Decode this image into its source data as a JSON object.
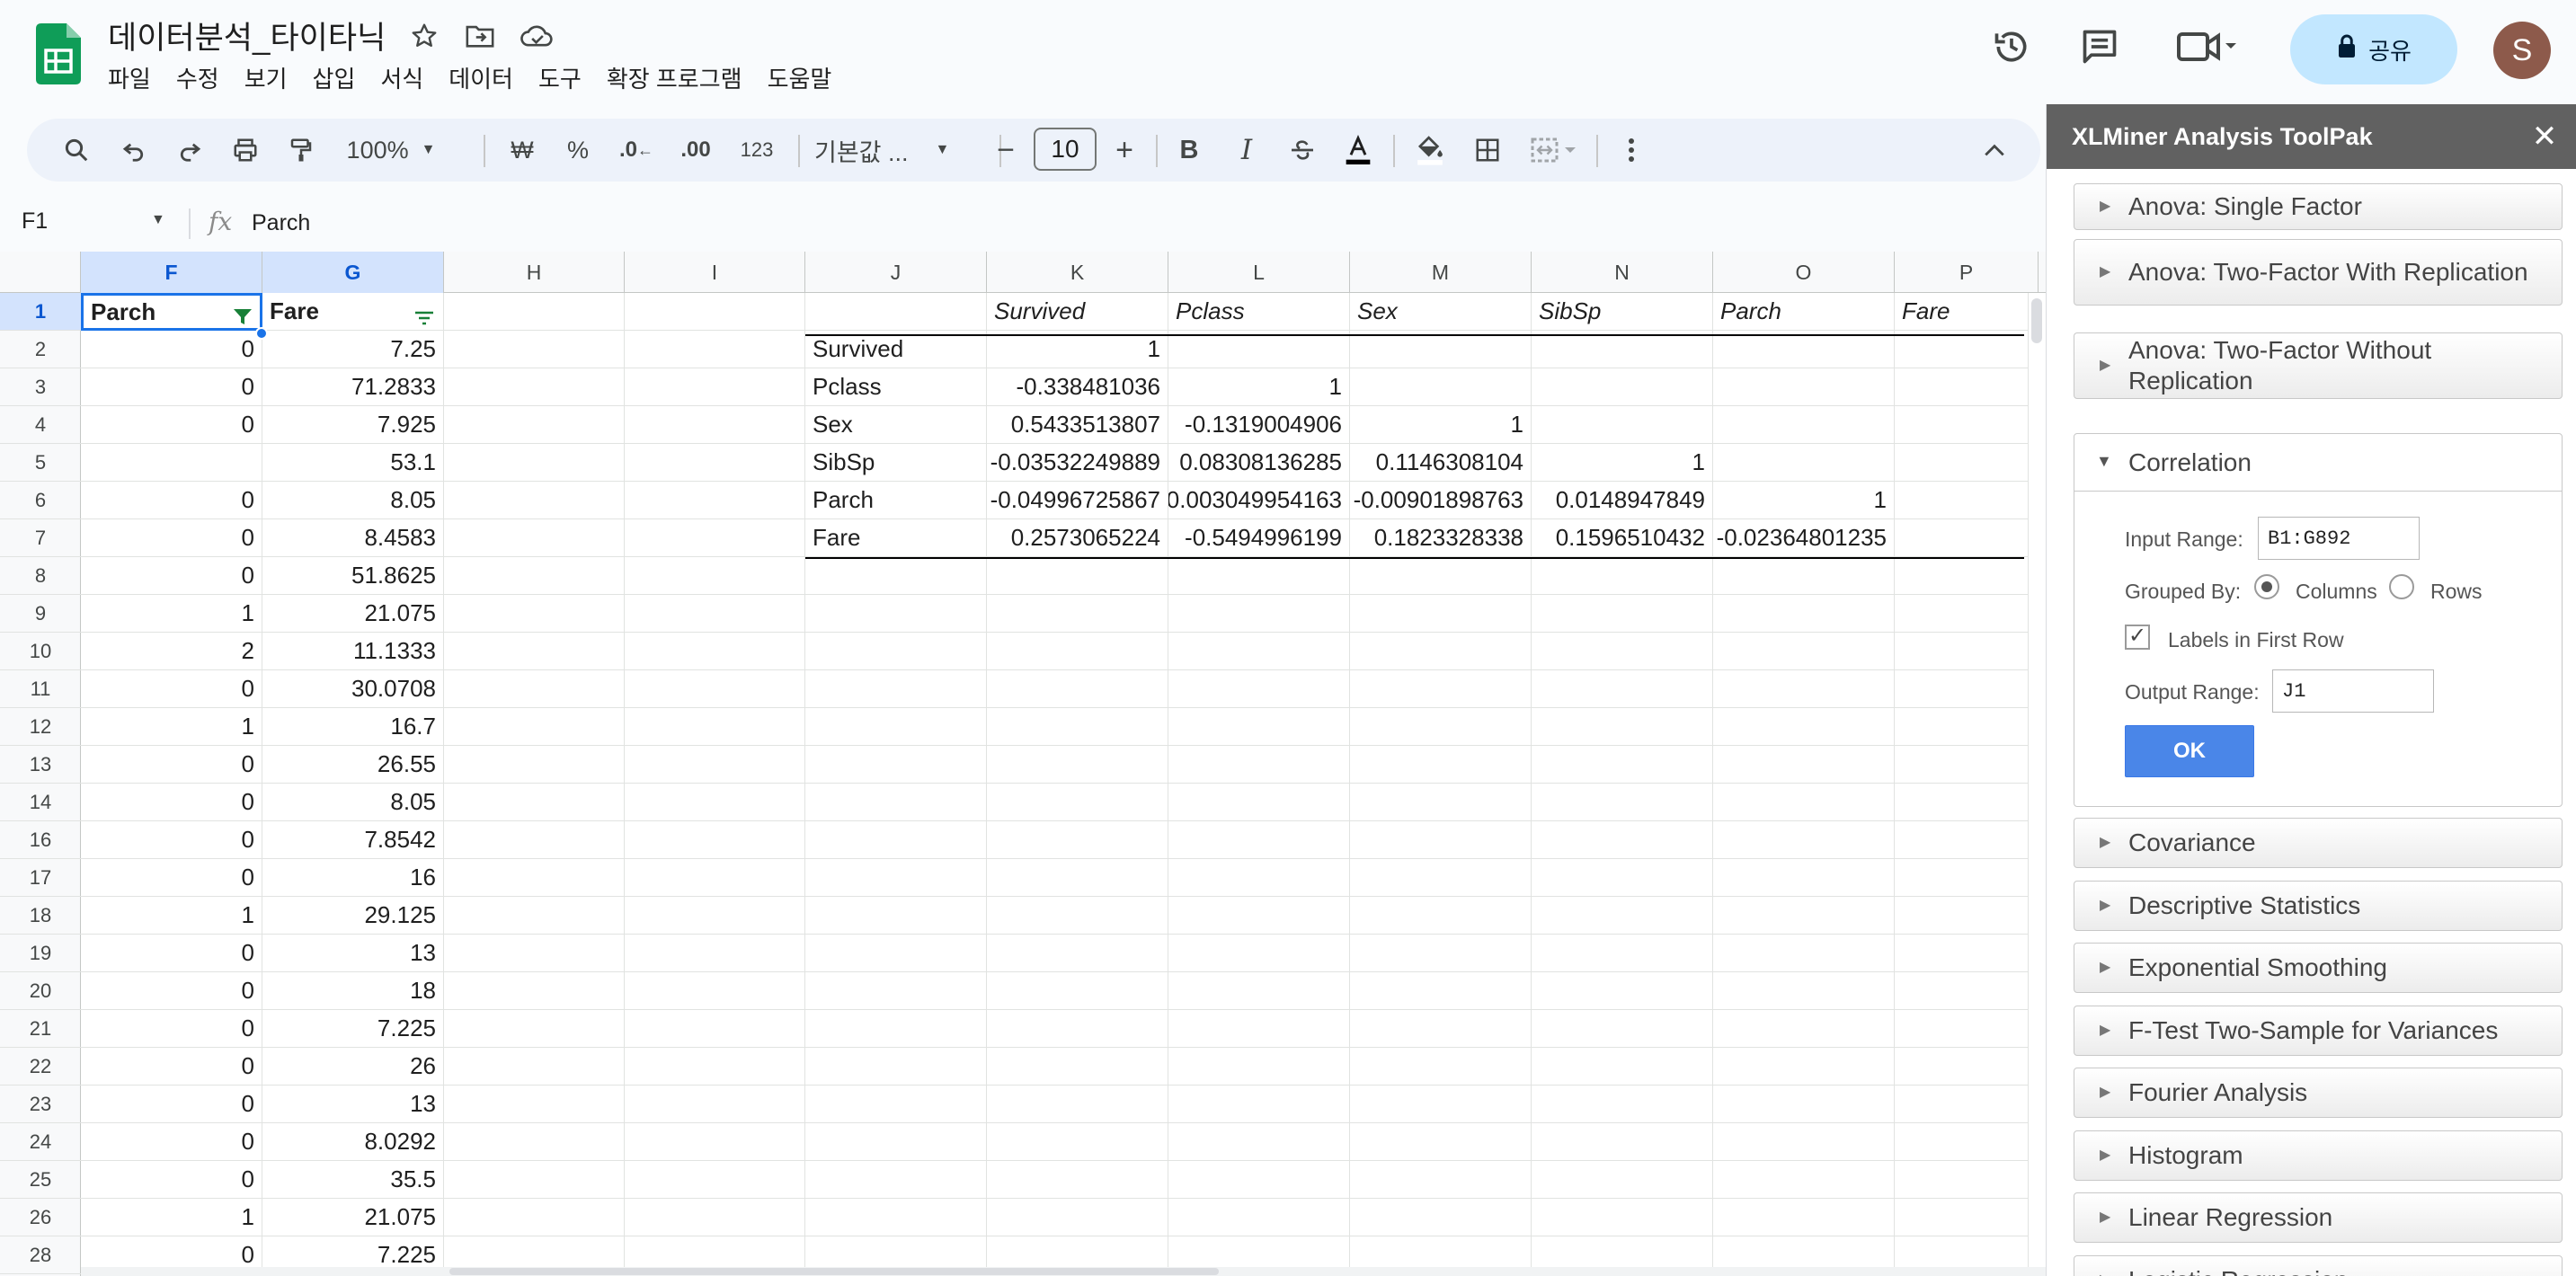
{
  "doc": {
    "title": "데이터분석_타이타닉"
  },
  "menu": [
    "파일",
    "수정",
    "보기",
    "삽입",
    "서식",
    "데이터",
    "도구",
    "확장 프로그램",
    "도움말"
  ],
  "share": {
    "label": "공유"
  },
  "user": {
    "initial": "S"
  },
  "toolbar": {
    "zoom": "100%",
    "currency": "₩",
    "percent": "%",
    "dec_minus": ".0",
    "dec_plus": ".00",
    "number_format": "123",
    "font": "기본값 ...",
    "font_size": "10",
    "bold": "B",
    "italic": "I"
  },
  "namebox": "F1",
  "formula": "Parch",
  "columns": [
    "F",
    "G",
    "H",
    "I",
    "J",
    "K",
    "L",
    "M",
    "N",
    "O",
    "P"
  ],
  "rows": [
    "1",
    "2",
    "3",
    "4",
    "5",
    "6",
    "7",
    "8",
    "9",
    "10",
    "11",
    "12",
    "13",
    "14",
    "16",
    "17",
    "18",
    "19",
    "20",
    "21",
    "22",
    "23",
    "24",
    "25",
    "26",
    "28"
  ],
  "col_f": [
    "Parch",
    "0",
    "0",
    "0",
    "",
    "0",
    "0",
    "0",
    "1",
    "2",
    "0",
    "1",
    "0",
    "0",
    "0",
    "0",
    "1",
    "0",
    "0",
    "0",
    "0",
    "0",
    "0",
    "0",
    "1",
    "0"
  ],
  "col_g": [
    "Fare",
    "7.25",
    "71.2833",
    "7.925",
    "53.1",
    "8.05",
    "8.4583",
    "51.8625",
    "21.075",
    "11.1333",
    "30.0708",
    "16.7",
    "26.55",
    "8.05",
    "7.8542",
    "16",
    "29.125",
    "13",
    "18",
    "7.225",
    "26",
    "13",
    "8.0292",
    "35.5",
    "21.075",
    "7.225"
  ],
  "corr": {
    "headers": [
      "Survived",
      "Pclass",
      "Sex",
      "SibSp",
      "Parch",
      "Fare"
    ],
    "rows": [
      {
        "label": "Survived",
        "values": [
          "1",
          "",
          "",
          "",
          "",
          ""
        ]
      },
      {
        "label": "Pclass",
        "values": [
          "-0.338481036",
          "1",
          "",
          "",
          "",
          ""
        ]
      },
      {
        "label": "Sex",
        "values": [
          "0.5433513807",
          "-0.1319004906",
          "1",
          "",
          "",
          ""
        ]
      },
      {
        "label": "SibSp",
        "values": [
          "-0.03532249889",
          "0.08308136285",
          "0.1146308104",
          "1",
          "",
          ""
        ]
      },
      {
        "label": "Parch",
        "values": [
          "-0.04996725867",
          "0.003049954163",
          "-0.00901898763",
          "0.0148947849",
          "1",
          ""
        ]
      },
      {
        "label": "Fare",
        "values": [
          "0.2573065224",
          "-0.5494996199",
          "0.1823328338",
          "0.1596510432",
          "-0.02364801235",
          ""
        ]
      }
    ]
  },
  "panel": {
    "title": "XLMiner Analysis ToolPak",
    "tools_above": [
      "Anova: Single Factor",
      "Anova: Two-Factor With Replication",
      "Anova: Two-Factor Without Replication"
    ],
    "correlation": {
      "name": "Correlation",
      "input_range_label": "Input Range:",
      "input_range": "B1:G892",
      "grouped_by_label": "Grouped By:",
      "columns_label": "Columns",
      "rows_label": "Rows",
      "labels_first_row": "Labels in First Row",
      "output_range_label": "Output Range:",
      "output_range": "J1",
      "ok": "OK"
    },
    "tools_below": [
      "Covariance",
      "Descriptive Statistics",
      "Exponential Smoothing",
      "F-Test Two-Sample for Variances",
      "Fourier Analysis",
      "Histogram",
      "Linear Regression",
      "Logistic Regression"
    ]
  }
}
